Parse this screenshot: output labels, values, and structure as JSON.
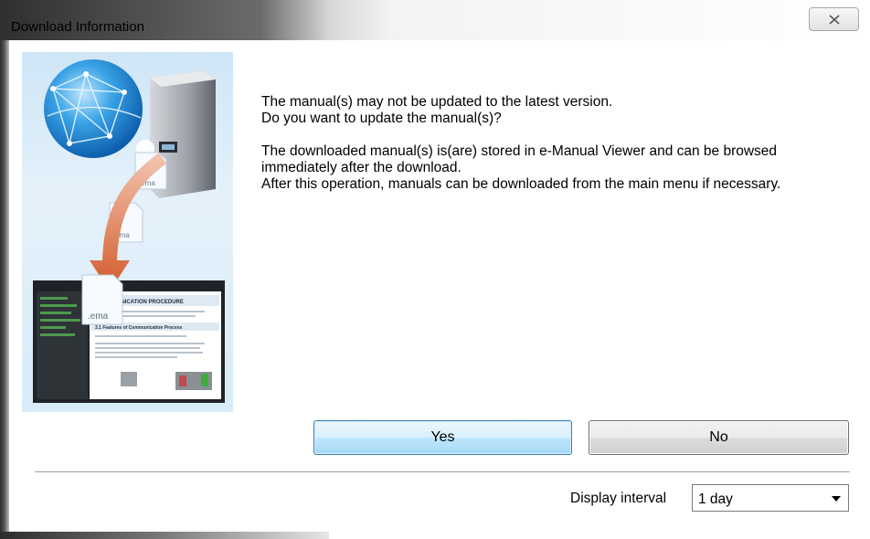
{
  "window": {
    "title": "Download Information",
    "close_glyph": "close-icon"
  },
  "illustration": {
    "file_labels": [
      ".ema",
      ".ema",
      ".ema"
    ],
    "screen_heading": "3 COMMUNICATION PROCEDURE",
    "screen_subheading": "3.1 Features of Communication Process"
  },
  "message": {
    "line1": "The manual(s) may not be updated to the latest version.",
    "line2": "Do you want to update the manual(s)?",
    "line3": "The downloaded manual(s) is(are) stored in e-Manual Viewer and can be browsed",
    "line4": "immediately after the download.",
    "line5": "After this operation, manuals can be downloaded from the main menu if necessary."
  },
  "buttons": {
    "yes": "Yes",
    "no": "No"
  },
  "display_interval": {
    "label": "Display interval",
    "selected": "1 day"
  },
  "colors": {
    "yes_border": "#3c7fb1",
    "arrow": "#d2592a",
    "globe": "#2a8fd6"
  }
}
